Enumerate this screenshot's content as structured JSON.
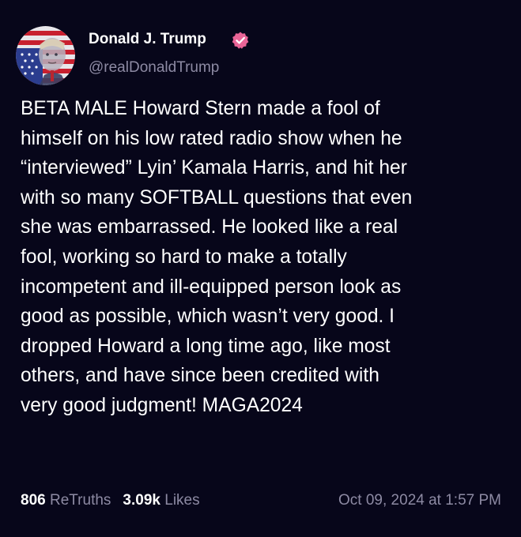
{
  "post": {
    "author": {
      "display_name": "Donald J. Trump",
      "handle": "@realDonaldTrump",
      "verified": true,
      "verified_icon": "verified-check-badge-icon",
      "verified_color": "#e96497"
    },
    "avatar_icon": "profile-avatar-flag-portrait",
    "text": "BETA MALE Howard Stern made a fool of\nhimself on his low rated radio show when he\n“interviewed” Lyin’ Kamala Harris, and hit her\nwith so many SOFTBALL questions that even\nshe was embarrassed. He looked like a real\nfool, working so hard to make a totally\nincompetent and ill-equipped person look as\ngood as possible, which wasn’t very good. I\ndropped Howard a long time ago, like most\nothers, and have since been credited with\nvery good judgment! MAGA2024",
    "stats": {
      "retruths_count": "806",
      "retruths_label": "ReTruths",
      "likes_count": "3.09k",
      "likes_label": "Likes"
    },
    "timestamp": "Oct 09, 2024 at 1:57 PM"
  },
  "colors": {
    "background": "#07061a",
    "primary_text": "#ffffff",
    "secondary_text": "#8d8aa3"
  }
}
